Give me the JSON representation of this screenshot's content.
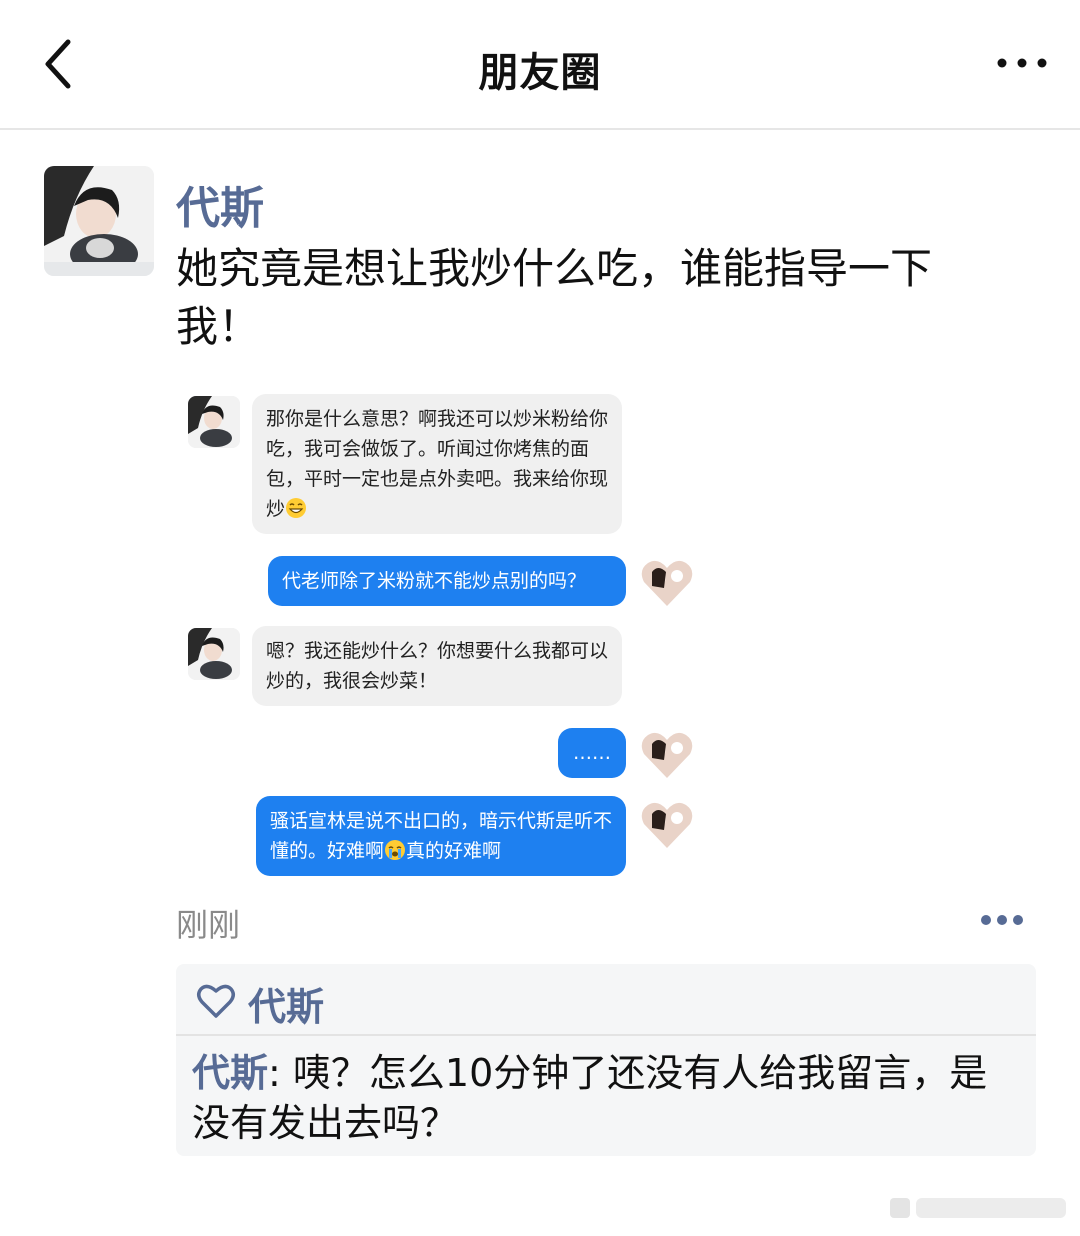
{
  "header": {
    "title": "朋友圈"
  },
  "post": {
    "author": "代斯",
    "text": "她究竟是想让我炒什么吃，谁能指导一下我！",
    "time": "刚刚"
  },
  "screenshot": {
    "messages": [
      {
        "side": "left",
        "text": "那你是什么意思？啊我还可以炒米粉给你吃，我可会做饭了。听闻过你烤焦的面包，平时一定也是点外卖吧。我来给你现炒"
      },
      {
        "side": "right",
        "text": "代老师除了米粉就不能炒点别的吗？"
      },
      {
        "side": "left",
        "text": "嗯？我还能炒什么？你想要什么我都可以炒的，我很会炒菜！"
      },
      {
        "side": "right",
        "text": "……"
      },
      {
        "side": "right",
        "text_a": "骚话宣林是说不出口的，暗示代斯是听不懂的。好难啊",
        "text_b": "真的好难啊"
      }
    ]
  },
  "likes": {
    "names": "代斯"
  },
  "comment": {
    "author": "代斯",
    "separator": ":",
    "text": " 咦？怎么10分钟了还没有人给我留言，是没有发出去吗？"
  },
  "colors": {
    "name_blue": "#576b95",
    "bubble_blue": "#1e80f0",
    "bubble_gray": "#f0f0f0"
  },
  "icons": [
    "back-arrow-icon",
    "more-dots-icon",
    "heart-outline-icon",
    "grin-emoji-icon",
    "crying-emoji-icon"
  ]
}
